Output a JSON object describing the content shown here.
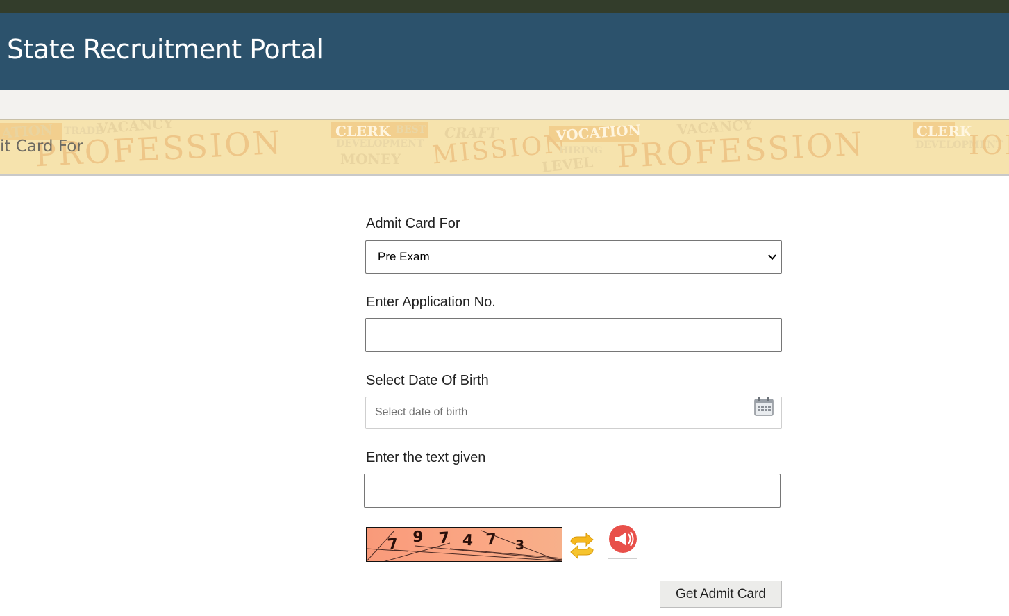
{
  "header": {
    "title": "State Recruitment Portal"
  },
  "banner": {
    "title": "it Card For",
    "watermark_words": [
      "PROFESSION",
      "CLERK",
      "VOCATION",
      "MONEY",
      "MISSION",
      "VACANCY",
      "TRADE",
      "DEVELOPMENT",
      "CRAFT",
      "LEVEL",
      "BEST",
      "HIRING"
    ]
  },
  "form": {
    "admit_card_label": "Admit Card For",
    "admit_card_selected": "Pre Exam",
    "application_label": "Enter Application No.",
    "application_value": "",
    "dob_label": "Select Date Of Birth",
    "dob_placeholder": "Select date of birth",
    "captcha_label": "Enter the text given",
    "captcha_value": "",
    "captcha_digits": [
      "7",
      "9",
      "7",
      "4",
      "7",
      "3"
    ],
    "submit_label": "Get Admit Card"
  },
  "colors": {
    "topbar": "#333d2b",
    "header": "#2c526c",
    "banner": "#f6e3ad",
    "captcha_bg": "#fba784",
    "refresh_arrow": "#f6b81e",
    "audio_icon": "#e8504a"
  },
  "icons": [
    "chevron-down-icon",
    "calendar-icon",
    "refresh-captcha-icon",
    "audio-captcha-icon"
  ]
}
